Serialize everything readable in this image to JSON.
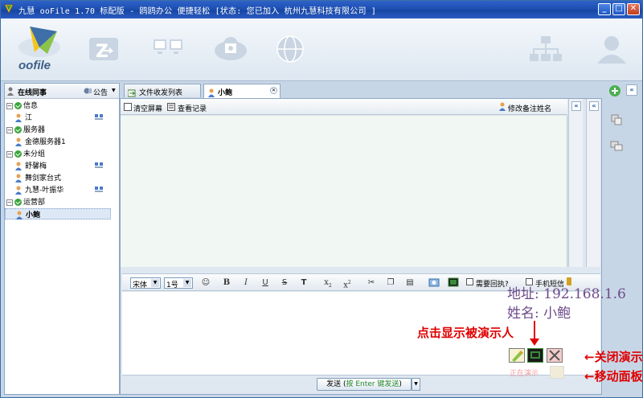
{
  "window": {
    "title": "九慧 ooFile 1.70 标配版 - 鸥鸥办公 便捷轻松 [状态: 您已加入 杭州九慧科技有限公司 ]",
    "min": "_",
    "max": "□",
    "close": "✕"
  },
  "logo": {
    "text": "oofile"
  },
  "left_panel": {
    "header": "在线同事",
    "notice": "公告",
    "tree": [
      {
        "type": "group",
        "label": "信息"
      },
      {
        "type": "user",
        "label": "江",
        "pc": true
      },
      {
        "type": "group",
        "label": "服务器"
      },
      {
        "type": "user",
        "label": "金德服务器1",
        "pc": false
      },
      {
        "type": "group",
        "label": "未分组"
      },
      {
        "type": "user",
        "label": "舒馨梅",
        "pc": true
      },
      {
        "type": "user",
        "label": "舞剑家台式",
        "pc": false
      },
      {
        "type": "user",
        "label": "九慧-叶振华",
        "pc": true
      },
      {
        "type": "group",
        "label": "运营部"
      },
      {
        "type": "user",
        "label": "小鲍",
        "pc": false,
        "selected": true
      }
    ]
  },
  "tabs": [
    {
      "label": "文件收发列表"
    },
    {
      "label": "小鲍",
      "active": true
    }
  ],
  "chat_toolbar": {
    "clear": "清空屏幕",
    "history": "查看记录",
    "edit_name": "修改备注姓名"
  },
  "format_bar": {
    "font": "宋体",
    "size": "1号",
    "need_reply": "需要回执?",
    "sms": "手机短信"
  },
  "send": {
    "prefix": "发送 (",
    "hint_green": "按 Enter 键发送",
    "suffix": ")"
  },
  "annotations": {
    "address": "地址: 192.168.1.6",
    "name": "姓名: 小鲍",
    "click_show": "点击显示被演示人",
    "close_demo": "←关闭演示",
    "move_panel": "←移动面板",
    "demo_status": "正在演示"
  },
  "colors": {
    "titlebar": "#1d4fb2",
    "chat_bg": "#f1f7f2",
    "annotation_red": "#e00000",
    "annotation_purple": "#6d4a8a"
  }
}
